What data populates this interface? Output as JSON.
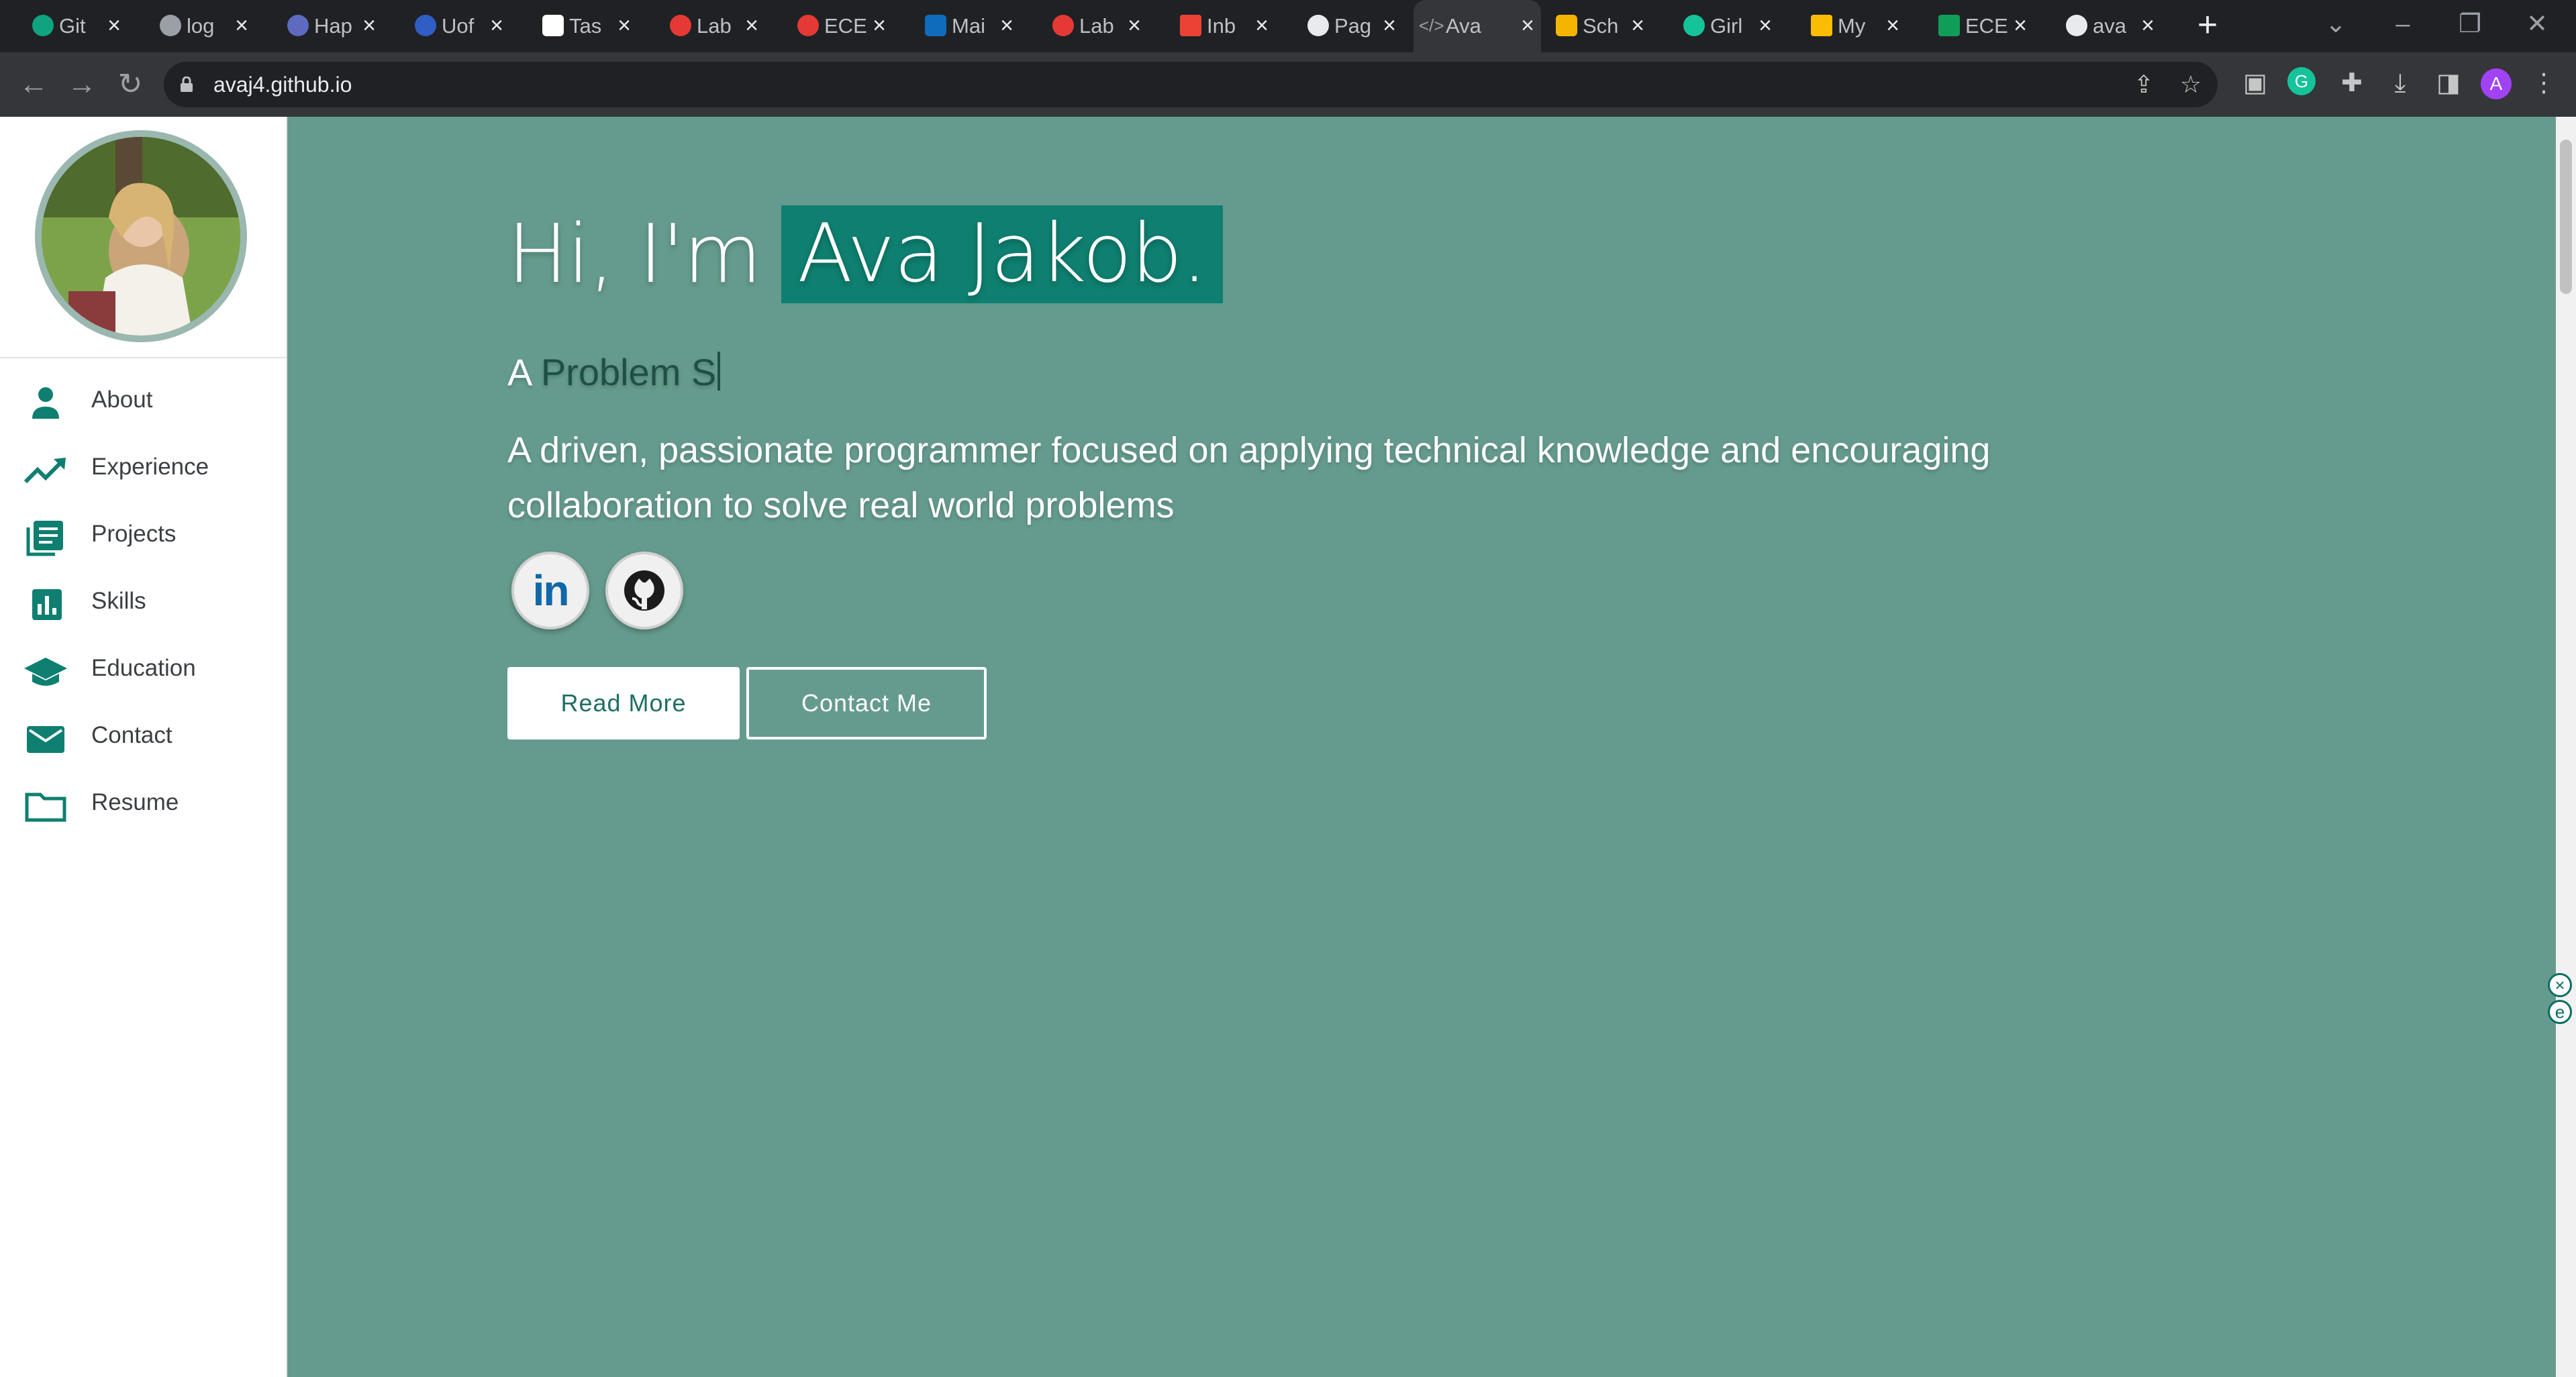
{
  "browser": {
    "tabs": [
      {
        "title": "Git",
        "favicon": "openai-icon"
      },
      {
        "title": "log",
        "favicon": "globe-icon"
      },
      {
        "title": "Hap",
        "favicon": "hap-icon"
      },
      {
        "title": "Uof",
        "favicon": "uof-icon"
      },
      {
        "title": "Tas",
        "favicon": "notion-icon"
      },
      {
        "title": "Lab",
        "favicon": "canvas-icon"
      },
      {
        "title": "ECE",
        "favicon": "canvas-icon"
      },
      {
        "title": "Mai",
        "favicon": "outlook-icon"
      },
      {
        "title": "Lab",
        "favicon": "canvas-icon"
      },
      {
        "title": "Inb",
        "favicon": "gmail-icon"
      },
      {
        "title": "Pag",
        "favicon": "github-icon"
      },
      {
        "title": "Ava",
        "favicon": "code-icon",
        "active": true
      },
      {
        "title": "Sch",
        "favicon": "shield-icon"
      },
      {
        "title": "Girl",
        "favicon": "grammarly-icon"
      },
      {
        "title": "My",
        "favicon": "drive-icon"
      },
      {
        "title": "ECE",
        "favicon": "sheets-icon"
      },
      {
        "title": "ava",
        "favicon": "github-icon"
      }
    ],
    "url": "avaj4.github.io",
    "profile_initial": "A",
    "extensions": [
      "keychain-icon",
      "grammarly-icon",
      "puzzle-icon",
      "download-icon",
      "sidepanel-icon"
    ],
    "accent_colors": {
      "chrome_dark": "#202124",
      "chrome_toolbar": "#35363a",
      "profile": "#a142f4"
    }
  },
  "sidebar": {
    "avatar_alt": "profile-photo",
    "items": [
      {
        "label": "About",
        "icon": "person-icon"
      },
      {
        "label": "Experience",
        "icon": "trending-up-icon"
      },
      {
        "label": "Projects",
        "icon": "library-books-icon"
      },
      {
        "label": "Skills",
        "icon": "bar-chart-icon"
      },
      {
        "label": "Education",
        "icon": "school-icon"
      },
      {
        "label": "Contact",
        "icon": "email-icon"
      },
      {
        "label": "Resume",
        "icon": "folder-icon"
      }
    ],
    "icon_color": "#0e7f70"
  },
  "hero": {
    "greeting_prefix": "Hi, I'm",
    "name": "Ava Jakob.",
    "role_prefix": "A",
    "role_typed": "Problem S",
    "tagline": "A driven, passionate programmer focused on applying technical knowledge and encouraging collaboration to solve real world problems",
    "social": [
      {
        "name": "LinkedIn",
        "text": "in"
      },
      {
        "name": "GitHub"
      }
    ],
    "buttons": {
      "read_more": "Read More",
      "contact_me": "Contact Me"
    },
    "background_color": "#659b8e",
    "highlight_color": "#0e7f70"
  }
}
